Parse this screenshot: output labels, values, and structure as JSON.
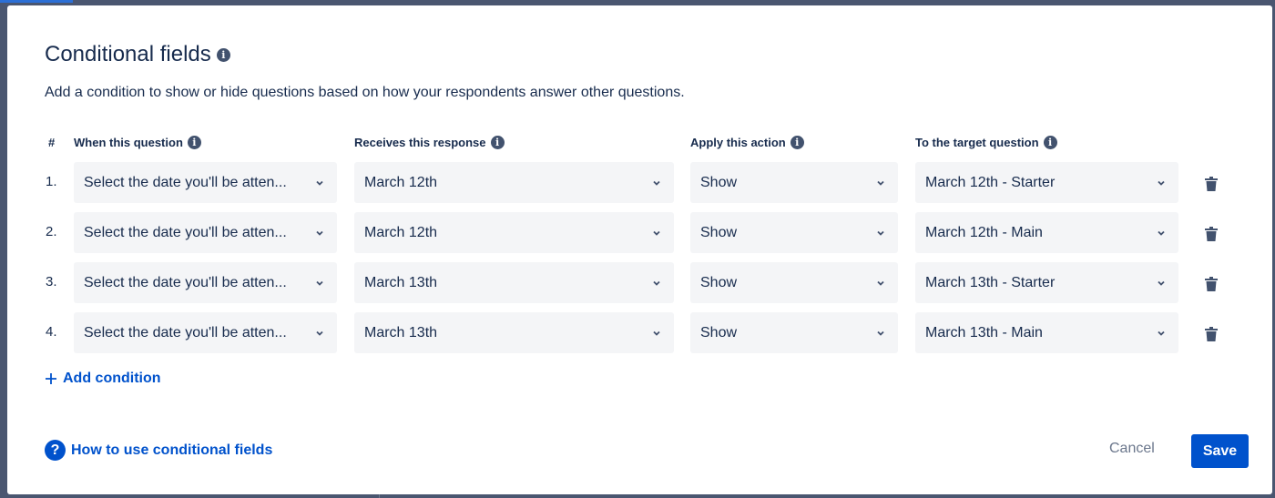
{
  "modal": {
    "title": "Conditional fields",
    "description": "Add a condition to show or hide questions based on how your respondents answer other questions."
  },
  "columns": {
    "num": "#",
    "question": "When this question",
    "response": "Receives this response",
    "action": "Apply this action",
    "target": "To the target question"
  },
  "rows": [
    {
      "num": "1.",
      "question": "Select the date you'll be atten...",
      "response": "March 12th",
      "action": "Show",
      "target": "March 12th - Starter"
    },
    {
      "num": "2.",
      "question": "Select the date you'll be atten...",
      "response": "March 12th",
      "action": "Show",
      "target": "March 12th - Main"
    },
    {
      "num": "3.",
      "question": "Select the date you'll be atten...",
      "response": "March 13th",
      "action": "Show",
      "target": "March 13th - Starter"
    },
    {
      "num": "4.",
      "question": "Select the date you'll be atten...",
      "response": "March 13th",
      "action": "Show",
      "target": "March 13th - Main"
    }
  ],
  "actions": {
    "add_condition": "Add condition",
    "help_link": "How to use conditional fields",
    "cancel": "Cancel",
    "save": "Save"
  },
  "colors": {
    "primary": "#0052cc",
    "text": "#172b4d",
    "field_bg": "#f4f5f7"
  }
}
